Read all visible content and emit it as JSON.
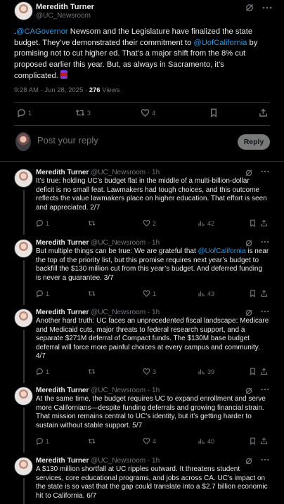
{
  "main_post": {
    "author_name": "Meredith Turner",
    "author_handle": "@UC_Newsroom",
    "text_segments": [
      {
        "text": ".",
        "link": false
      },
      {
        "text": "@CAGovernor",
        "link": true
      },
      {
        "text": " Newsom and the Legislature have finalized the state budget. They’ve demonstrated their commitment to ",
        "link": false
      },
      {
        "text": "@UofCalifornia",
        "link": true
      },
      {
        "text": " by promising not to cut higher ed. That’s a major shift from the 8% cut proposed earlier this year. But, as always in Sacramento, it’s complicated.",
        "link": false
      }
    ],
    "emoji": "scroll-emoji",
    "time": "9:28 AM · Jun 28, 2025 · ",
    "views_count": "276",
    "views_label": " Views",
    "stats": {
      "replies": "1",
      "reposts": "3",
      "likes": "4"
    }
  },
  "composer": {
    "placeholder": "Post your reply",
    "button_label": "Reply"
  },
  "replies": [
    {
      "name": "Meredith Turner",
      "handle": "@UC_Newsroom",
      "time": " · 1h",
      "text_segments": [
        {
          "text": "It’s true: holding UC’s budget flat in the middle of a multi-billion-dollar deficit is no small feat. Lawmakers had tough choices, and this outcome reflects the value lawmakers place on higher education. That effort is seen and appreciated. 2/7",
          "link": false
        }
      ],
      "stats": {
        "replies": "1",
        "reposts": "",
        "likes": "2",
        "views": "42"
      }
    },
    {
      "name": "Meredith Turner",
      "handle": "@UC_Newsroom",
      "time": " · 1h",
      "text_segments": [
        {
          "text": "But multiple things can be true: We are grateful that ",
          "link": false
        },
        {
          "text": "@UofCalifornia",
          "link": true
        },
        {
          "text": " is near the top of the priority list, but this promise requires next year’s budget to backfill the $130 million cut from this year’s budget. And deferred funding is never a guarantee. 3/7",
          "link": false
        }
      ],
      "stats": {
        "replies": "1",
        "reposts": "",
        "likes": "1",
        "views": "43"
      }
    },
    {
      "name": "Meredith Turner",
      "handle": "@UC_Newsroom",
      "time": " · 1h",
      "text_segments": [
        {
          "text": "Another hard truth: UC faces an unprecedented fiscal landscape: Medicare and Medicaid cuts, major threats to federal research support, and a separate $271M deferral of Compact funds. The $130M base budget deferral will force more painful choices at every campus and community. 4/7",
          "link": false
        }
      ],
      "stats": {
        "replies": "1",
        "reposts": "",
        "likes": "3",
        "views": "39"
      }
    },
    {
      "name": "Meredith Turner",
      "handle": "@UC_Newsroom",
      "time": " · 1h",
      "text_segments": [
        {
          "text": "At the same time, the budget requires UC to expand enrollment and serve more Californians—despite funding deferrals and growing financial strain. That mission remains central to UC’s identity, but it’s getting harder to sustain without stable support. 5/7",
          "link": false
        }
      ],
      "stats": {
        "replies": "1",
        "reposts": "",
        "likes": "4",
        "views": "40"
      }
    },
    {
      "name": "Meredith Turner",
      "handle": "@UC_Newsroom",
      "time": " · 1h",
      "text_segments": [
        {
          "text": "A $130 million shortfall at UC ripples outward. It threatens student services, core educational programs, and jobs across CA. UC’s impact on the state is so vast that the gap could translate into a $2.7 billion economic hit to California. 6/7",
          "link": false
        }
      ],
      "stats": {
        "replies": "",
        "reposts": "",
        "likes": "",
        "views": ""
      }
    }
  ],
  "colors": {
    "background": "#000000",
    "text": "#e7e9ea",
    "muted": "#71767b",
    "link": "#1d9bf0",
    "divider": "#2f3336",
    "reply_button": "#787a7a"
  }
}
